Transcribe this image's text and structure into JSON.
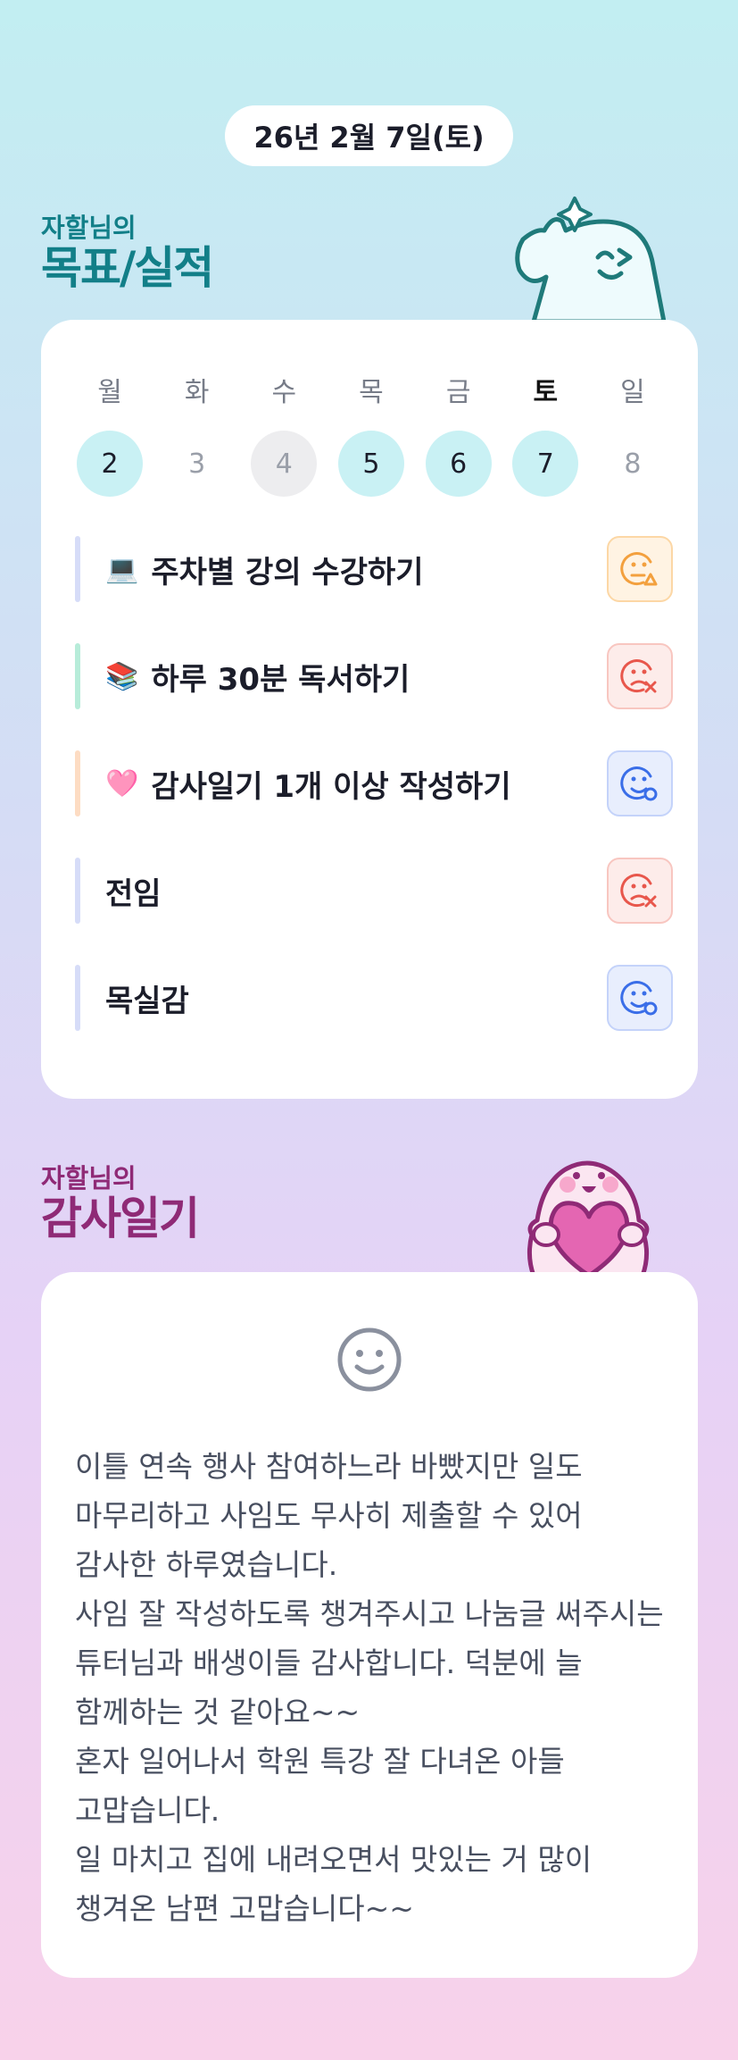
{
  "date": "26년 2월 7일(토)",
  "goals_section": {
    "sub": "자할님의",
    "title": "목표/실적"
  },
  "week": [
    {
      "name": "월",
      "num": "2",
      "state": "done",
      "today": false
    },
    {
      "name": "화",
      "num": "3",
      "state": "none",
      "today": false
    },
    {
      "name": "수",
      "num": "4",
      "state": "fail",
      "today": false
    },
    {
      "name": "목",
      "num": "5",
      "state": "done",
      "today": false
    },
    {
      "name": "금",
      "num": "6",
      "state": "done",
      "today": false
    },
    {
      "name": "토",
      "num": "7",
      "state": "done",
      "today": true
    },
    {
      "name": "일",
      "num": "8",
      "state": "none",
      "today": false
    }
  ],
  "goals": [
    {
      "emoji": "💻",
      "label": "주차별 강의 수강하기",
      "bar_color": "#d6dcf8",
      "status": "partial",
      "status_icon": "face-warning-icon"
    },
    {
      "emoji": "📚",
      "label": "하루 30분 독서하기",
      "bar_color": "#b7ecd9",
      "status": "fail",
      "status_icon": "face-x-icon"
    },
    {
      "emoji": "🩷",
      "label": "감사일기 1개 이상 작성하기",
      "bar_color": "#fddcc3",
      "status": "done",
      "status_icon": "face-check-icon"
    },
    {
      "emoji": "",
      "label": "전임",
      "bar_color": "#d6dcf8",
      "status": "fail",
      "status_icon": "face-x-icon"
    },
    {
      "emoji": "",
      "label": "목실감",
      "bar_color": "#d6dcf8",
      "status": "done",
      "status_icon": "face-check-icon"
    }
  ],
  "diary_section": {
    "sub": "자할님의",
    "title": "감사일기"
  },
  "diary": {
    "mood_icon": "smile-icon",
    "text": "이틀 연속 행사 참여하느라 바빴지만 일도 마무리하고 사임도 무사히 제출할 수 있어 감사한 하루였습니다.\n사임 잘 작성하도록 챙겨주시고 나눔글 써주시는 튜터님과 배생이들 감사합니다. 덕분에 늘 함께하는 것 같아요~~\n혼자 일어나서 학원 특강 잘 다녀온 아들 고맙습니다.\n일 마치고 집에 내려오면서 맛있는 거 많이 챙겨온 남편 고맙습니다~~"
  },
  "colors": {
    "goal_title": "#127f88",
    "diary_title": "#8f2a76",
    "done_bg": "#c9f1f4"
  }
}
